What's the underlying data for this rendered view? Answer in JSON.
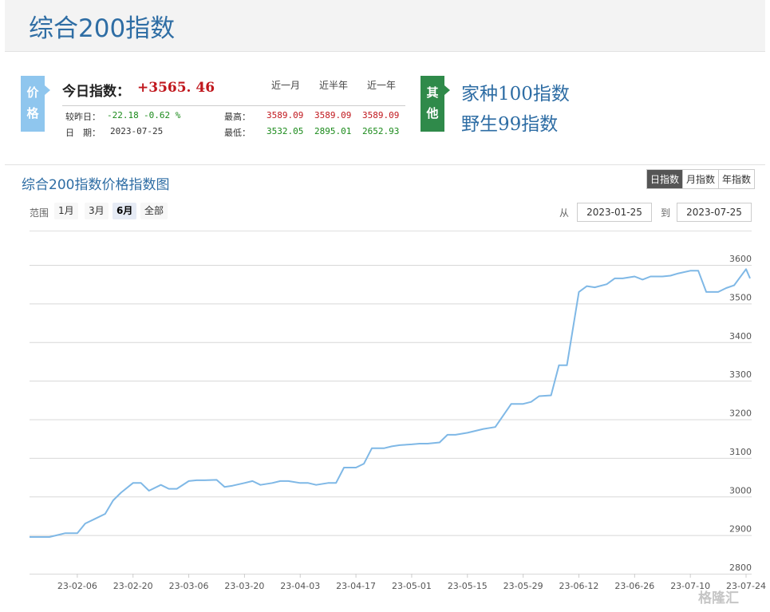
{
  "page_title": "综合200指数",
  "price_tag": [
    "价",
    "格"
  ],
  "other_tag": [
    "其",
    "他"
  ],
  "today": {
    "label": "今日指数：",
    "value": "+3565. 46"
  },
  "periods": [
    "近一月",
    "近半年",
    "近一年"
  ],
  "change": {
    "label": "较昨日：",
    "abs": "-22.18",
    "pct": "-0.62 %"
  },
  "date": {
    "label": "日　期：",
    "value": "2023-07-25"
  },
  "high": {
    "label": "最高：",
    "values": [
      "3589.09",
      "3589.09",
      "3589.09"
    ]
  },
  "low": {
    "label": "最低：",
    "values": [
      "3532.05",
      "2895.01",
      "2652.93"
    ]
  },
  "other_links": [
    "家种100指数",
    "野生99指数"
  ],
  "chart_title": "综合200指数价格指数图",
  "view_tabs": [
    "日指数",
    "月指数",
    "年指数"
  ],
  "range": {
    "label": "范围",
    "buttons": [
      "1月",
      "3月",
      "6月",
      "全部"
    ],
    "selected": "6月"
  },
  "from": {
    "label": "从",
    "value": "2023-01-25"
  },
  "to": {
    "label": "到",
    "value": "2023-07-25"
  },
  "watermark": "格隆汇",
  "colors": {
    "line": "#7fb8e6",
    "title": "#2e6da4",
    "up": "#c0171d",
    "down": "#1a8a1a"
  },
  "chart_data": {
    "type": "line",
    "x_tick_labels": [
      "23-02-06",
      "23-02-20",
      "23-03-06",
      "23-03-20",
      "23-04-03",
      "23-04-17",
      "23-05-01",
      "23-05-15",
      "23-05-29",
      "23-06-12",
      "23-06-26",
      "23-07-10",
      "23-07-24"
    ],
    "y_tick_labels": [
      "2800",
      "2900",
      "3000",
      "3100",
      "3200",
      "3300",
      "3400",
      "3500",
      "3600"
    ],
    "ylim": [
      2780,
      3630
    ],
    "x": [
      "2023-01-25",
      "2023-01-30",
      "2023-02-01",
      "2023-02-03",
      "2023-02-06",
      "2023-02-08",
      "2023-02-10",
      "2023-02-13",
      "2023-02-15",
      "2023-02-17",
      "2023-02-20",
      "2023-02-22",
      "2023-02-24",
      "2023-02-27",
      "2023-03-01",
      "2023-03-03",
      "2023-03-06",
      "2023-03-08",
      "2023-03-10",
      "2023-03-13",
      "2023-03-15",
      "2023-03-17",
      "2023-03-20",
      "2023-03-22",
      "2023-03-24",
      "2023-03-27",
      "2023-03-29",
      "2023-03-31",
      "2023-04-03",
      "2023-04-05",
      "2023-04-07",
      "2023-04-10",
      "2023-04-12",
      "2023-04-14",
      "2023-04-17",
      "2023-04-19",
      "2023-04-21",
      "2023-04-24",
      "2023-04-26",
      "2023-04-28",
      "2023-05-01",
      "2023-05-03",
      "2023-05-05",
      "2023-05-08",
      "2023-05-10",
      "2023-05-12",
      "2023-05-15",
      "2023-05-17",
      "2023-05-19",
      "2023-05-22",
      "2023-05-24",
      "2023-05-26",
      "2023-05-29",
      "2023-05-31",
      "2023-06-02",
      "2023-06-05",
      "2023-06-07",
      "2023-06-09",
      "2023-06-12",
      "2023-06-14",
      "2023-06-16",
      "2023-06-19",
      "2023-06-21",
      "2023-06-23",
      "2023-06-26",
      "2023-06-28",
      "2023-06-30",
      "2023-07-03",
      "2023-07-05",
      "2023-07-07",
      "2023-07-10",
      "2023-07-12",
      "2023-07-14",
      "2023-07-17",
      "2023-07-19",
      "2023-07-21",
      "2023-07-24",
      "2023-07-25"
    ],
    "series": [
      {
        "values": [
          2895,
          2895,
          2900,
          2905,
          2905,
          2930,
          2940,
          2955,
          2990,
          3010,
          3035,
          3035,
          3015,
          3030,
          3020,
          3020,
          3040,
          3042,
          3042,
          3043,
          3025,
          3028,
          3035,
          3040,
          3030,
          3035,
          3040,
          3040,
          3035,
          3035,
          3030,
          3035,
          3035,
          3075,
          3075,
          3085,
          3125,
          3125,
          3130,
          3133,
          3135,
          3137,
          3137,
          3140,
          3160,
          3160,
          3165,
          3170,
          3175,
          3180,
          3210,
          3240,
          3240,
          3245,
          3260,
          3262,
          3340,
          3340,
          3530,
          3545,
          3542,
          3550,
          3565,
          3565,
          3570,
          3562,
          3570,
          3570,
          3572,
          3578,
          3585,
          3585,
          3530,
          3530,
          3540,
          3547,
          3589,
          3565
        ]
      }
    ]
  }
}
